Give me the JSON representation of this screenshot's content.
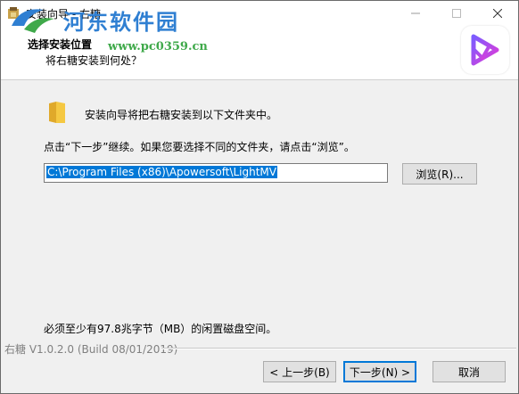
{
  "window": {
    "title": "安装向导 - 右糖",
    "minimize_icon": "minimize-icon",
    "maximize_icon": "maximize-icon",
    "close_icon": "close-icon"
  },
  "watermark": {
    "title": "河东软件园",
    "url": "www.pc0359.cn"
  },
  "header": {
    "title": "选择安装位置",
    "subtitle": "将右糖安装到何处？"
  },
  "content": {
    "folder_text": "安装向导将把右糖安装到以下文件夹中。",
    "instruction": "点击“下一步”继续。如果您要选择不同的文件夹，请点击“浏览”。",
    "path_value": "C:\\Program Files (x86)\\Apowersoft\\LightMV",
    "browse_label": "浏览(R)...",
    "disk_space": "必须至少有97.8兆字节（MB）的闲置磁盘空间。"
  },
  "footer": {
    "version": "右糖 V1.0.2.0  (Build 08/01/2019)",
    "back_label": "< 上一步(B)",
    "next_label": "下一步(N) >",
    "cancel_label": "取消"
  },
  "colors": {
    "accent": "#0078d7",
    "logo_gradient": [
      "#7b5cff",
      "#e23ad6"
    ]
  }
}
